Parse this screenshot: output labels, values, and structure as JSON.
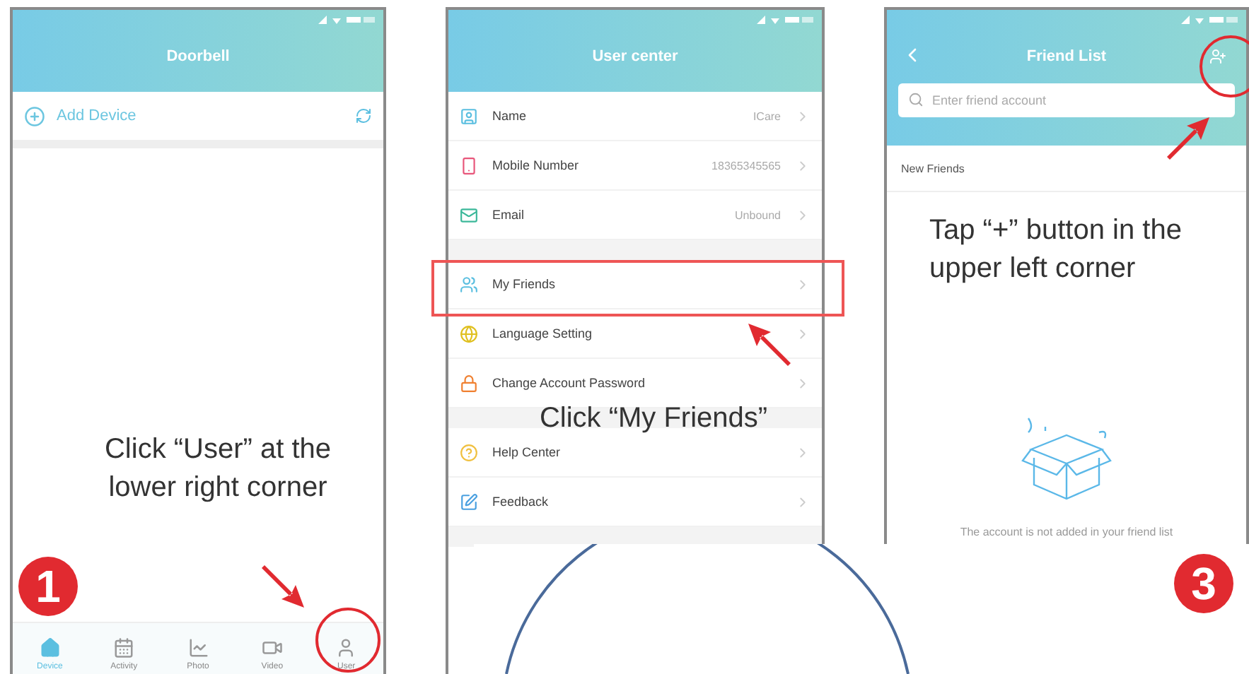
{
  "screens": [
    {
      "kind": "device_list",
      "header": {
        "title": "Doorbell"
      },
      "add_device": {
        "label": "Add Device"
      },
      "tabs": [
        {
          "label": "Device",
          "selected": true
        },
        {
          "label": "Activity",
          "selected": false
        },
        {
          "label": "Photo",
          "selected": false
        },
        {
          "label": "Video",
          "selected": false
        },
        {
          "label": "User",
          "selected": false
        }
      ],
      "caption": "Click “User” at the lower right corner",
      "badge": "1"
    },
    {
      "kind": "user_center",
      "header": {
        "title": "User center"
      },
      "groups": [
        [
          {
            "label": "Name",
            "value": "ICare"
          },
          {
            "label": "Mobile Number",
            "value": "18365345565"
          },
          {
            "label": "Email",
            "value": "Unbound"
          }
        ],
        [
          {
            "label": "My Friends"
          },
          {
            "label": "Language Setting"
          },
          {
            "label": "Change Account Password"
          }
        ],
        [
          {
            "label": "Help Center"
          },
          {
            "label": "Feedback"
          }
        ]
      ],
      "caption": "Click “My Friends”"
    },
    {
      "kind": "friend_list",
      "header": {
        "title": "Friend List"
      },
      "search": {
        "placeholder": "Enter friend account"
      },
      "section": "New Friends",
      "empty_message": "The account is not added in your friend list",
      "caption": "Tap “+” button in the upper left corner",
      "badge": "3"
    }
  ]
}
